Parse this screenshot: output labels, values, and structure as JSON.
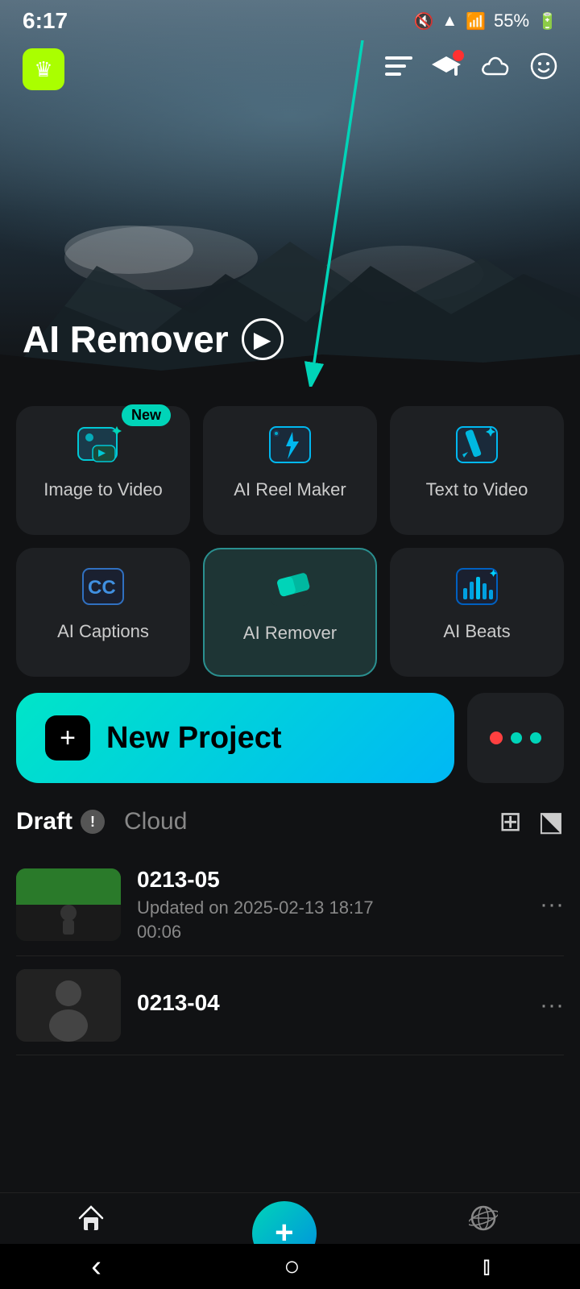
{
  "statusBar": {
    "time": "6:17",
    "battery": "55%",
    "mute": "🔇",
    "wifi": "📶",
    "signal1": "📶",
    "signal2": "📶"
  },
  "header": {
    "appLogo": "♛",
    "navIcons": [
      "list-filter-icon",
      "graduation-icon",
      "cloud-icon",
      "emoji-icon"
    ]
  },
  "heroSection": {
    "title": "AI Remover",
    "arrowLabel": "▶"
  },
  "toolGrid": {
    "items": [
      {
        "id": "image-to-video",
        "label": "Image to Video",
        "isNew": true
      },
      {
        "id": "ai-reel-maker",
        "label": "AI Reel Maker",
        "isNew": false
      },
      {
        "id": "text-to-video",
        "label": "Text to Video",
        "isNew": false
      },
      {
        "id": "ai-captions",
        "label": "AI Captions",
        "isNew": false
      },
      {
        "id": "ai-remover",
        "label": "AI Remover",
        "isNew": false,
        "highlighted": true
      },
      {
        "id": "ai-beats",
        "label": "AI Beats",
        "isNew": false
      }
    ],
    "newBadgeLabel": "New"
  },
  "newProject": {
    "buttonLabel": "New Project",
    "buttonIcon": "+"
  },
  "draftSection": {
    "tabs": [
      {
        "label": "Draft",
        "active": true
      },
      {
        "label": "Cloud",
        "active": false
      }
    ],
    "infoBadge": "!",
    "items": [
      {
        "name": "0213-05",
        "updatedLabel": "Updated on 2025-02-13 18:17",
        "duration": "00:06",
        "thumbType": "green"
      },
      {
        "name": "0213-04",
        "updatedLabel": "",
        "duration": "",
        "thumbType": "dark"
      }
    ]
  },
  "bottomNav": {
    "homeLabel": "Home",
    "exploreLabel": "Explore",
    "centerIcon": "+"
  },
  "sysNav": {
    "back": "‹",
    "home": "○",
    "recent": "⫾"
  }
}
